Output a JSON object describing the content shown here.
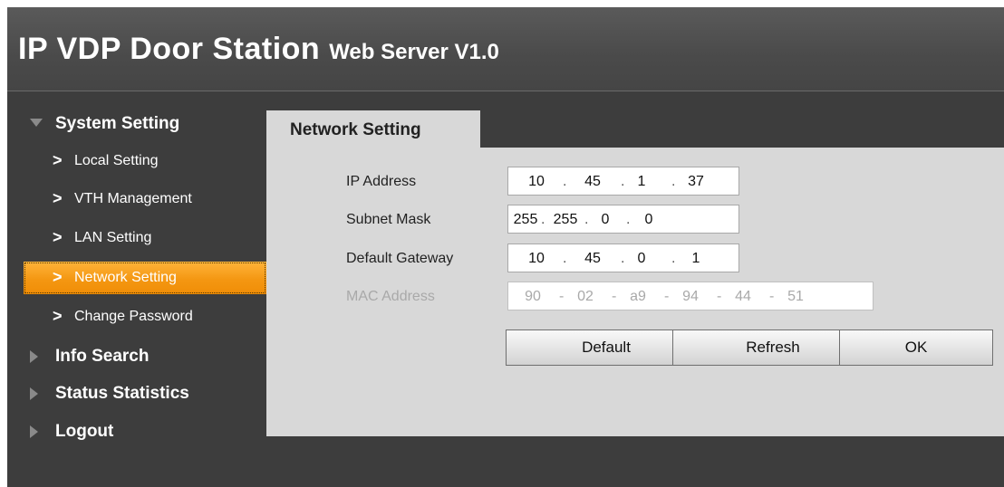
{
  "header": {
    "title": "IP VDP Door Station",
    "subtitle": "Web Server V1.0"
  },
  "sidebar": {
    "items": [
      {
        "label": "System Setting",
        "type": "section",
        "expanded": true,
        "icon": "triangle-down-icon"
      },
      {
        "label": "Local Setting",
        "type": "sub",
        "icon": "chevron-right-icon"
      },
      {
        "label": "VTH Management",
        "type": "sub",
        "icon": "chevron-right-icon"
      },
      {
        "label": "LAN Setting",
        "type": "sub",
        "icon": "chevron-right-icon"
      },
      {
        "label": "Network Setting",
        "type": "sub",
        "active": true,
        "icon": "chevron-right-icon"
      },
      {
        "label": "Change Password",
        "type": "sub",
        "icon": "chevron-right-icon"
      },
      {
        "label": "Info Search",
        "type": "section",
        "expanded": false,
        "icon": "triangle-right-icon"
      },
      {
        "label": "Status Statistics",
        "type": "section",
        "expanded": false,
        "icon": "triangle-right-icon"
      },
      {
        "label": "Logout",
        "type": "section",
        "expanded": false,
        "icon": "triangle-right-icon"
      }
    ],
    "chevron": ">"
  },
  "main": {
    "tab_label": "Network Setting",
    "fields": {
      "ip": {
        "label": "IP Address",
        "octets": [
          "10",
          "45",
          "1",
          "37"
        ]
      },
      "subnet": {
        "label": "Subnet Mask",
        "octets": [
          "255",
          "255",
          "0",
          "0"
        ]
      },
      "gateway": {
        "label": "Default Gateway",
        "octets": [
          "10",
          "45",
          "0",
          "1"
        ]
      },
      "mac": {
        "label": "MAC Address",
        "parts": [
          "90",
          "02",
          "a9",
          "94",
          "44",
          "51"
        ],
        "disabled": true
      }
    },
    "ip_separator": ".",
    "mac_separator": "-",
    "buttons": {
      "default": "Default",
      "refresh": "Refresh",
      "ok": "OK"
    }
  },
  "colors": {
    "header_bg": "#4a4a4a",
    "body_bg": "#3d3d3d",
    "panel_bg": "#d8d8d8",
    "active_item": "#f49712",
    "disabled_text": "#a9a9a9"
  }
}
